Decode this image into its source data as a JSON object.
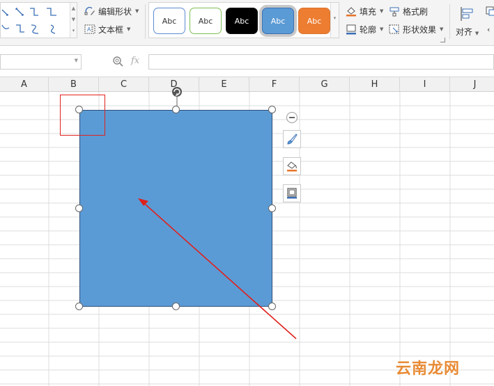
{
  "ribbon": {
    "edit_shape_label": "编辑形状",
    "text_box_label": "文本框",
    "style_presets": [
      "Abc",
      "Abc",
      "Abc",
      "Abc",
      "Abc"
    ],
    "fill_label": "填充",
    "format_painter_label": "格式刷",
    "outline_label": "轮廓",
    "shape_effects_label": "形状效果",
    "align_label": "对齐"
  },
  "formula_bar": {
    "name_box_value": "",
    "fx_label": "fx",
    "formula_value": ""
  },
  "columns": [
    "A",
    "B",
    "C",
    "D",
    "E",
    "F",
    "G",
    "H",
    "I",
    "J"
  ],
  "shape": {
    "fill_color": "#5b9bd5",
    "outline_color": "#2f4e7a"
  },
  "annotation": {
    "color": "#e0201c"
  },
  "watermark": "云南龙网",
  "icons": {
    "float_tools": [
      "brush-icon",
      "fill-bucket-icon",
      "outline-icon"
    ],
    "collapse": "minus-circle-icon",
    "rotate": "rotate-handle-icon"
  }
}
